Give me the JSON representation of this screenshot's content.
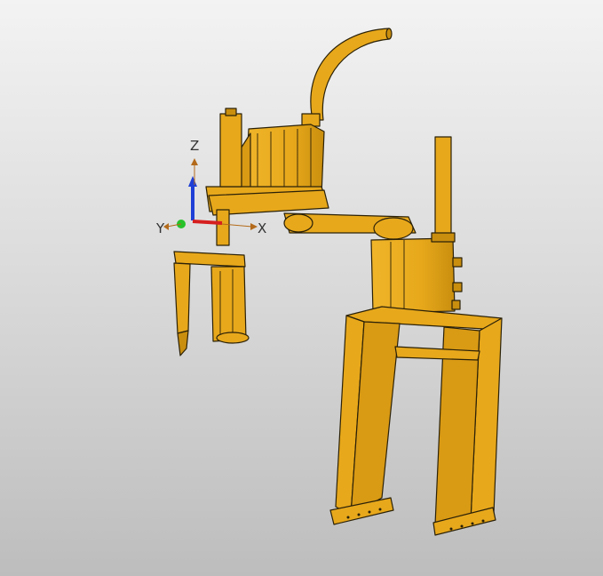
{
  "viewport": {
    "background_top": "#f3f3f3",
    "background_bottom": "#bdbdbd"
  },
  "model": {
    "color": "#e7a81b",
    "shade": "#c98e0e",
    "edge": "#2b2108"
  },
  "triad": {
    "z_label": "Z",
    "x_label": "X",
    "y_label": "Y",
    "z_color": "#1f3fd6",
    "x_color": "#d61f1f",
    "y_color": "#27c22b"
  }
}
